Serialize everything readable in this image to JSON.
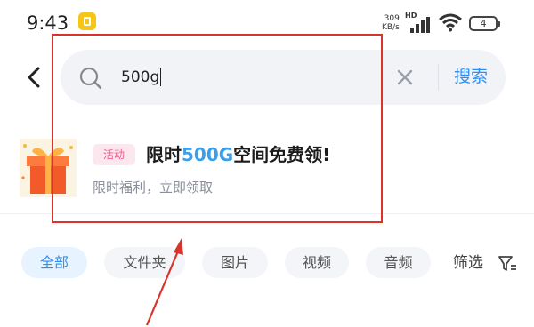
{
  "status_bar": {
    "time": "9:43",
    "net_speed_value": "309",
    "net_speed_unit": "KB/s",
    "hd": "HD",
    "battery": "4"
  },
  "search": {
    "query": "500g",
    "button_label": "搜索"
  },
  "promo": {
    "tag": "活动",
    "title_prefix": "限时",
    "title_highlight": "500G",
    "title_suffix": "空间免费领!",
    "subtitle": "限时福利，立即领取",
    "highlight_color": "#3a9fea"
  },
  "filters": {
    "chips": [
      "全部",
      "文件夹",
      "图片",
      "视频",
      "音频"
    ],
    "active_index": 0,
    "filter_label": "筛选"
  },
  "colors": {
    "accent": "#2f8ff5",
    "tag_text": "#ef5a8d",
    "annotation": "#d9342b"
  },
  "icons": [
    "notification-app-icon",
    "signal-icon",
    "wifi-icon",
    "battery-icon",
    "back-arrow-icon",
    "search-icon",
    "clear-icon",
    "gift-icon",
    "filter-icon"
  ]
}
